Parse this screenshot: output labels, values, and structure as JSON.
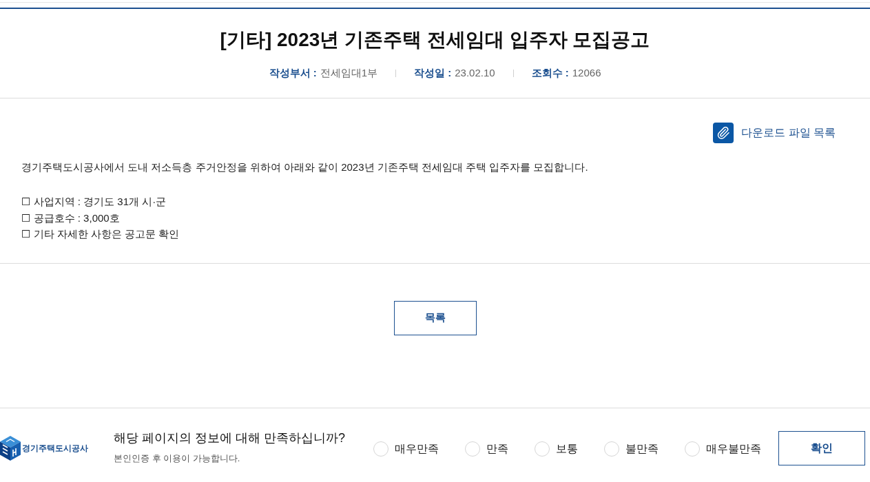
{
  "notice": {
    "title": "[기타] 2023년 기존주택 전세임대 입주자 모집공고",
    "meta": [
      {
        "label": "작성부서 :",
        "value": "전세임대1부"
      },
      {
        "label": "작성일 :",
        "value": "23.02.10"
      },
      {
        "label": "조회수 :",
        "value": "12066"
      }
    ],
    "download_link": "다운로드 파일 목록",
    "body": "경기주택도시공사에서 도내 저소득층 주거안정을 위하여 아래와 같이 2023년 기존주택 전세임대 주택 입주자를 모집합니다.",
    "items": [
      "☐ 사업지역 : 경기도 31개 시·군",
      "☐ 공급호수 : 3,000호",
      "☐ 기타 자세한 사항은 공고문 확인"
    ],
    "list_button": "목록"
  },
  "survey": {
    "logo_text": "경기주택도시공사",
    "question": "해당 페이지의 정보에 대해 만족하십니까?",
    "note": "본인인증 후 이용이 가능합니다.",
    "options": [
      {
        "label": "매우만족",
        "selected": false
      },
      {
        "label": "만족",
        "selected": false
      },
      {
        "label": "보통",
        "selected": false
      },
      {
        "label": "불만족",
        "selected": false
      },
      {
        "label": "매우불만족",
        "selected": false
      }
    ],
    "submit_button": "확인"
  }
}
